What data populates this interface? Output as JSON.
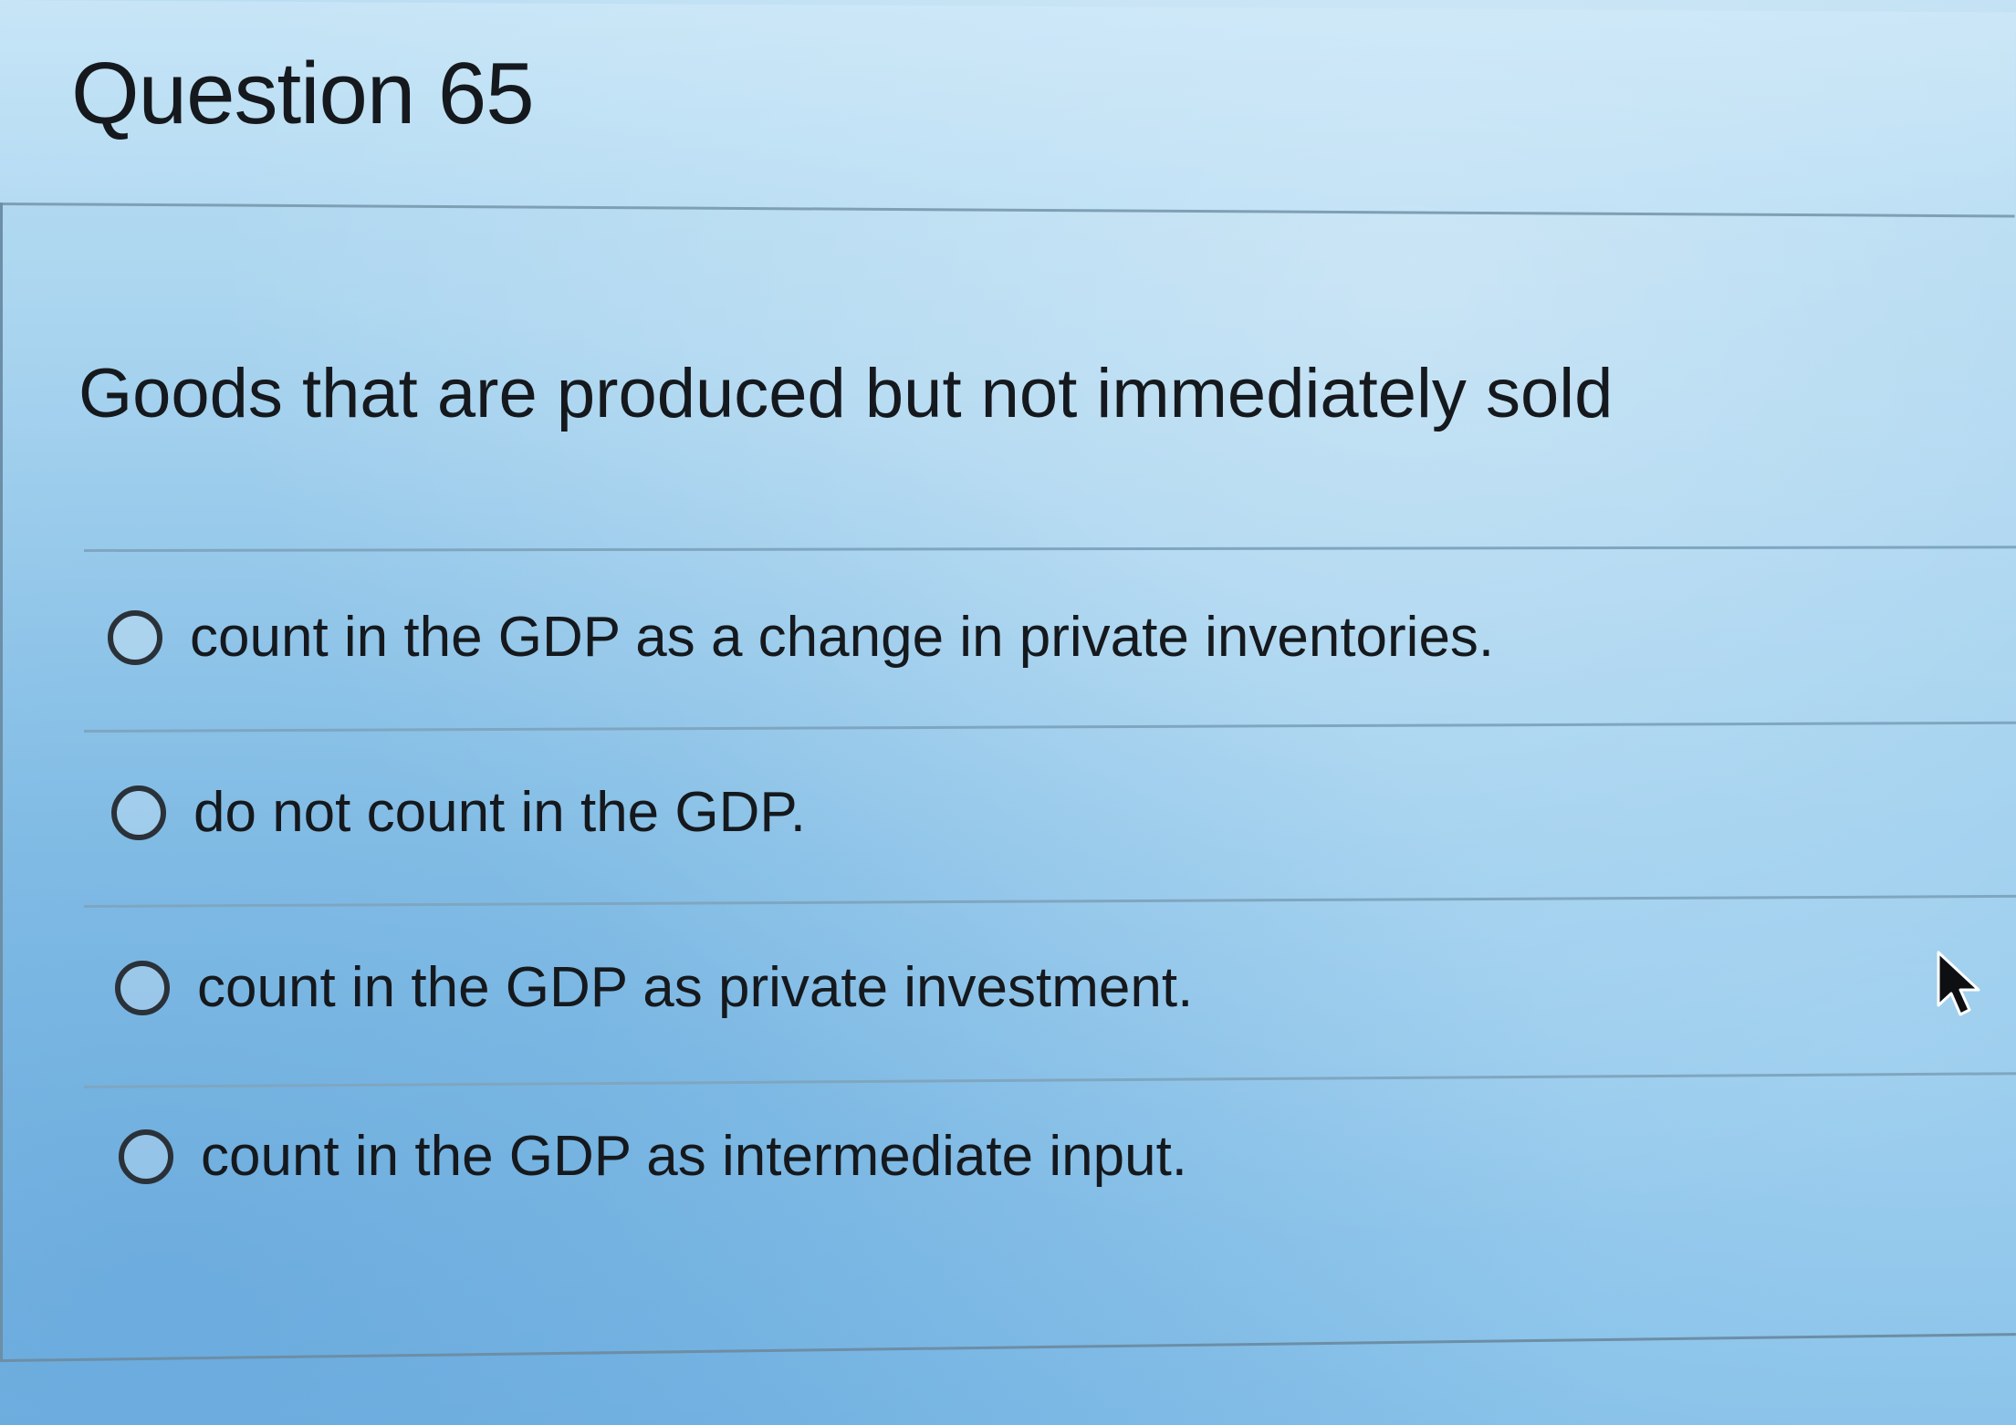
{
  "question": {
    "title": "Question 65",
    "prompt": "Goods that are produced but not immediately sold"
  },
  "options": [
    {
      "label": "count in the GDP as a change in private inventories.",
      "selected": false
    },
    {
      "label": "do not count in the GDP.",
      "selected": false
    },
    {
      "label": "count in the GDP as private investment.",
      "selected": false
    },
    {
      "label": "count in the GDP as intermediate input.",
      "selected": false
    }
  ],
  "icons": {
    "radio": "radio-button-icon",
    "cursor": "mouse-pointer-icon"
  },
  "colors": {
    "background": "#a6d3ef",
    "text": "#15191d",
    "divider": "#7fa6c0"
  }
}
